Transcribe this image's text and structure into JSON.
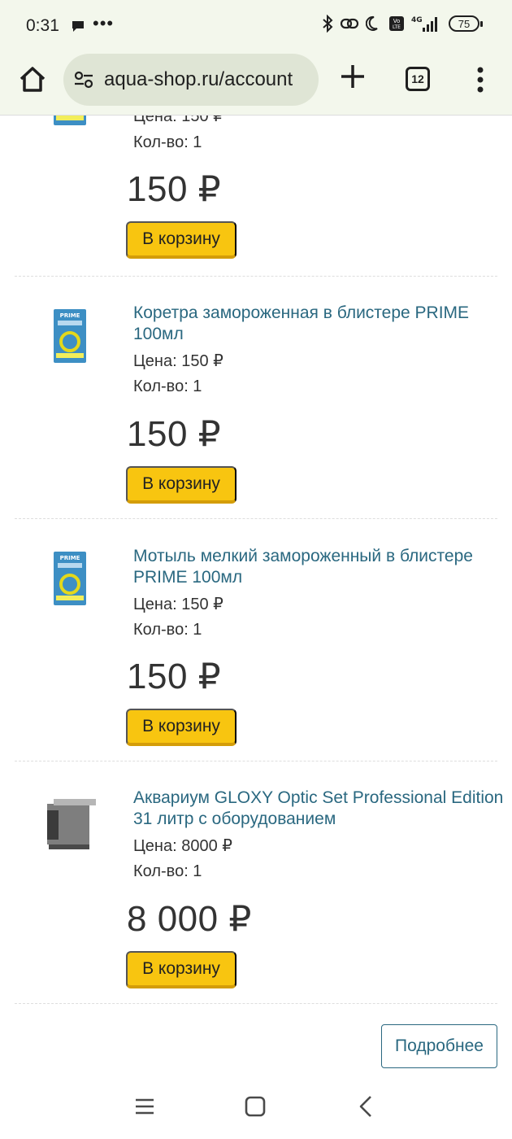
{
  "status_bar": {
    "time": "0:31",
    "dots": "•••",
    "battery": "75",
    "network": "4G"
  },
  "browser": {
    "url": "aqua-shop.ru/account",
    "tab_count": "12"
  },
  "items": [
    {
      "title": "",
      "price_line": "Цена: 150 ₽",
      "qty_line": "Кол-во: 1",
      "price": "150 ₽",
      "cart_label": "В корзину"
    },
    {
      "title": "Коретра замороженная в блистере PRIME 100мл",
      "price_line": "Цена: 150 ₽",
      "qty_line": "Кол-во: 1",
      "price": "150 ₽",
      "cart_label": "В корзину"
    },
    {
      "title": "Мотыль мелкий замороженный в блистере PRIME 100мл",
      "price_line": "Цена: 150 ₽",
      "qty_line": "Кол-во: 1",
      "price": "150 ₽",
      "cart_label": "В корзину"
    },
    {
      "title": "Аквариум GLOXY Optic Set Professional Edition 31 литр с оборудованием",
      "price_line": "Цена: 8000 ₽",
      "qty_line": "Кол-во: 1",
      "price": "8 000 ₽",
      "cart_label": "В корзину"
    }
  ],
  "more_button": "Подробнее",
  "colors": {
    "accent_link": "#2a6880",
    "cart_button": "#f8c510",
    "browser_bar": "#f3f7ec"
  }
}
